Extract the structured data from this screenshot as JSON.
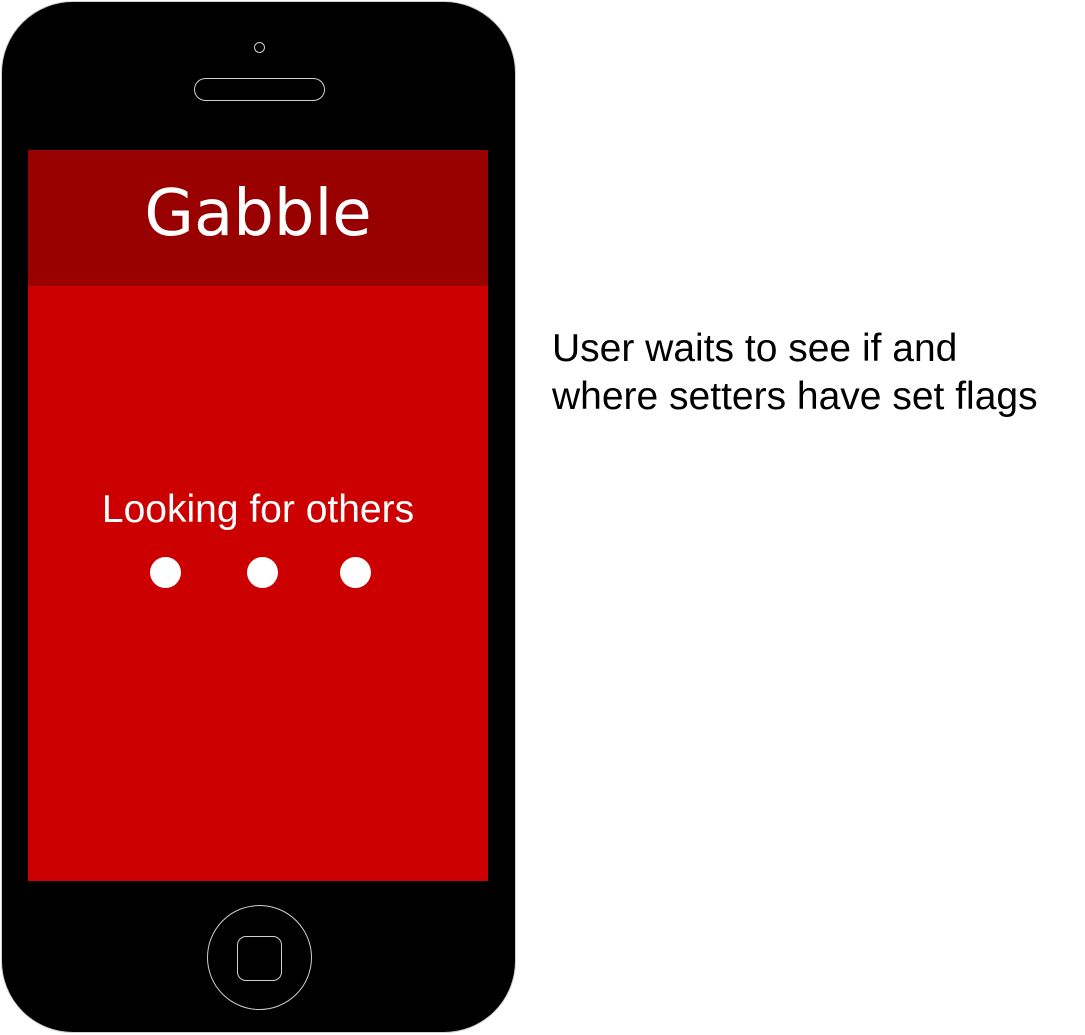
{
  "app": {
    "title": "Gabble"
  },
  "screen": {
    "status_text": "Looking for others",
    "loading_dots": 3
  },
  "annotation": {
    "text": "User waits to see if and\nwhere setters have set flags"
  },
  "colors": {
    "header_bg": "#990000",
    "screen_bg": "#cc0000",
    "phone_body": "#000000",
    "text_on_screen": "#ffffff"
  }
}
